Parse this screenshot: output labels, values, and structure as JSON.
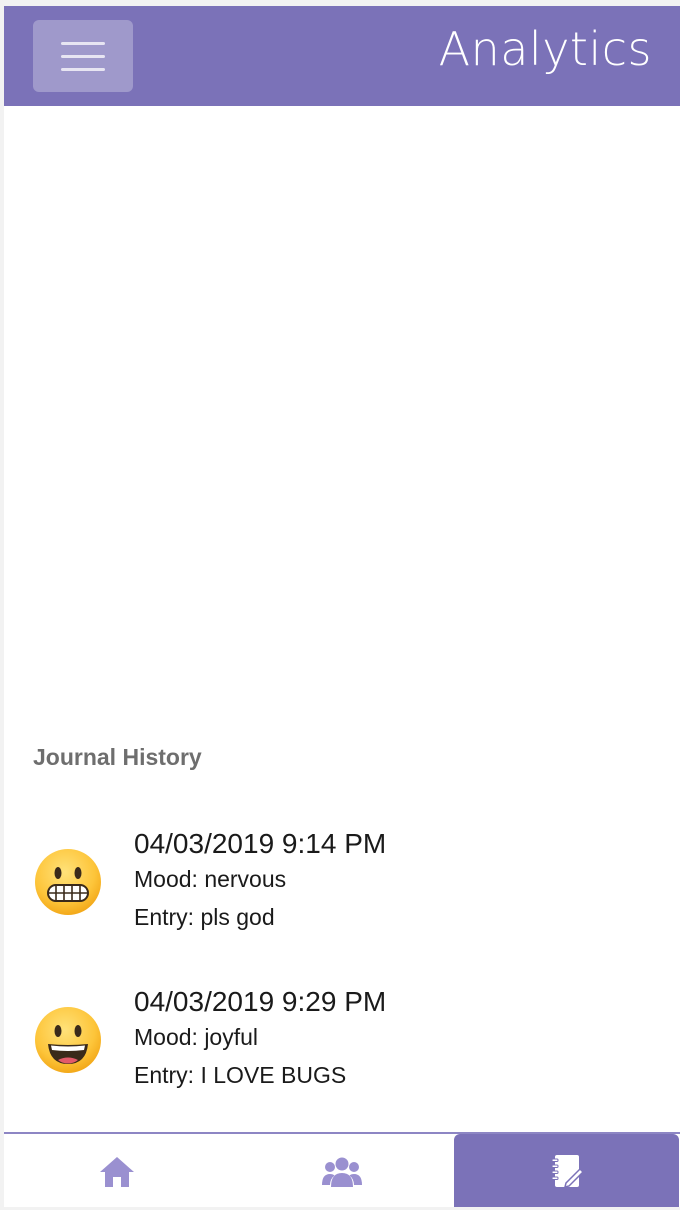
{
  "header": {
    "title": "Analytics",
    "menu_icon": "hamburger-menu-icon"
  },
  "journal": {
    "section_title": "Journal History",
    "entries": [
      {
        "datetime": "04/03/2019 9:14 PM",
        "mood": "Mood: nervous",
        "entry": "Entry: pls god",
        "icon": "grimacing-face-icon"
      },
      {
        "datetime": "04/03/2019 9:29 PM",
        "mood": "Mood: joyful",
        "entry": "Entry: I LOVE BUGS",
        "icon": "grinning-face-icon"
      }
    ]
  },
  "bottom_nav": {
    "items": [
      {
        "icon": "home-icon",
        "active": false
      },
      {
        "icon": "users-icon",
        "active": false
      },
      {
        "icon": "journal-icon",
        "active": true
      }
    ]
  },
  "colors": {
    "brand": "#7b72b8",
    "nav_icon": "#9a90d0",
    "section_title": "#6e6e6e",
    "text": "#1a1a1a"
  }
}
